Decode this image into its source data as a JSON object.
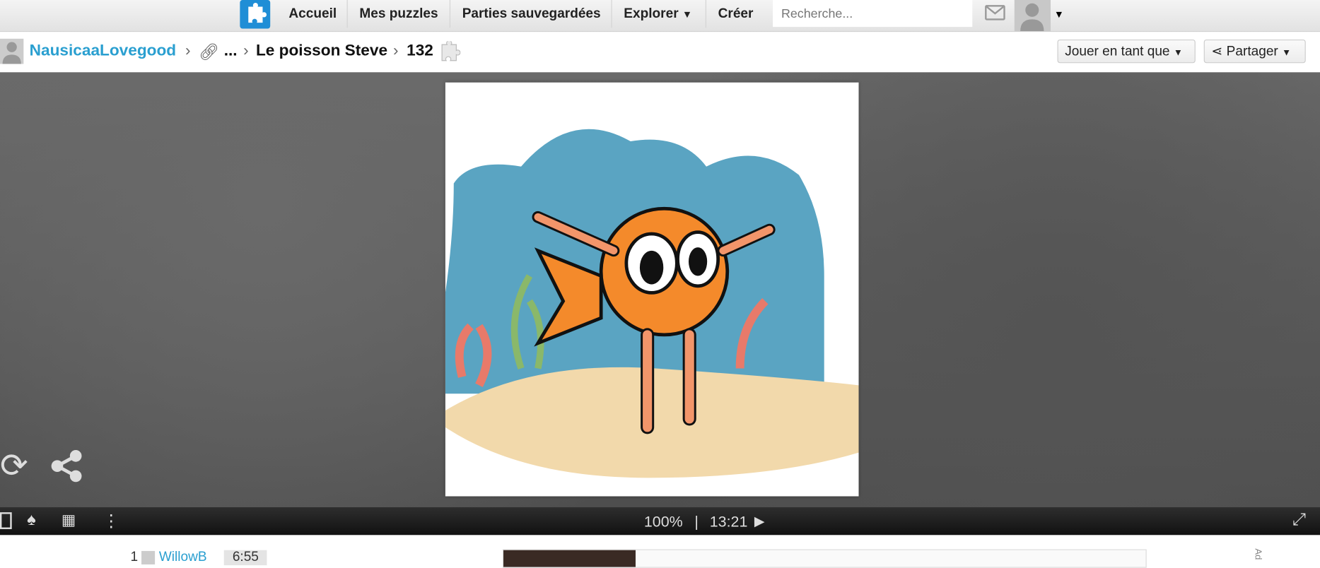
{
  "nav": {
    "items": [
      "Accueil",
      "Mes puzzles",
      "Parties sauvegardées",
      "Explorer",
      "Créer"
    ],
    "search_placeholder": "Recherche..."
  },
  "breadcrumb": {
    "user": "NausicaaLovegood",
    "ellipsis": "...",
    "title": "Le poisson Steve",
    "pieces": "132"
  },
  "actions": {
    "play_as": "Jouer en tant que",
    "share": "Partager"
  },
  "toolbar": {
    "zoom": "100%",
    "separator": "|",
    "time": "13:21"
  },
  "scores": [
    {
      "rank": "1",
      "name": "WillowB",
      "time": "6:55"
    }
  ],
  "ad_label": "Ad"
}
